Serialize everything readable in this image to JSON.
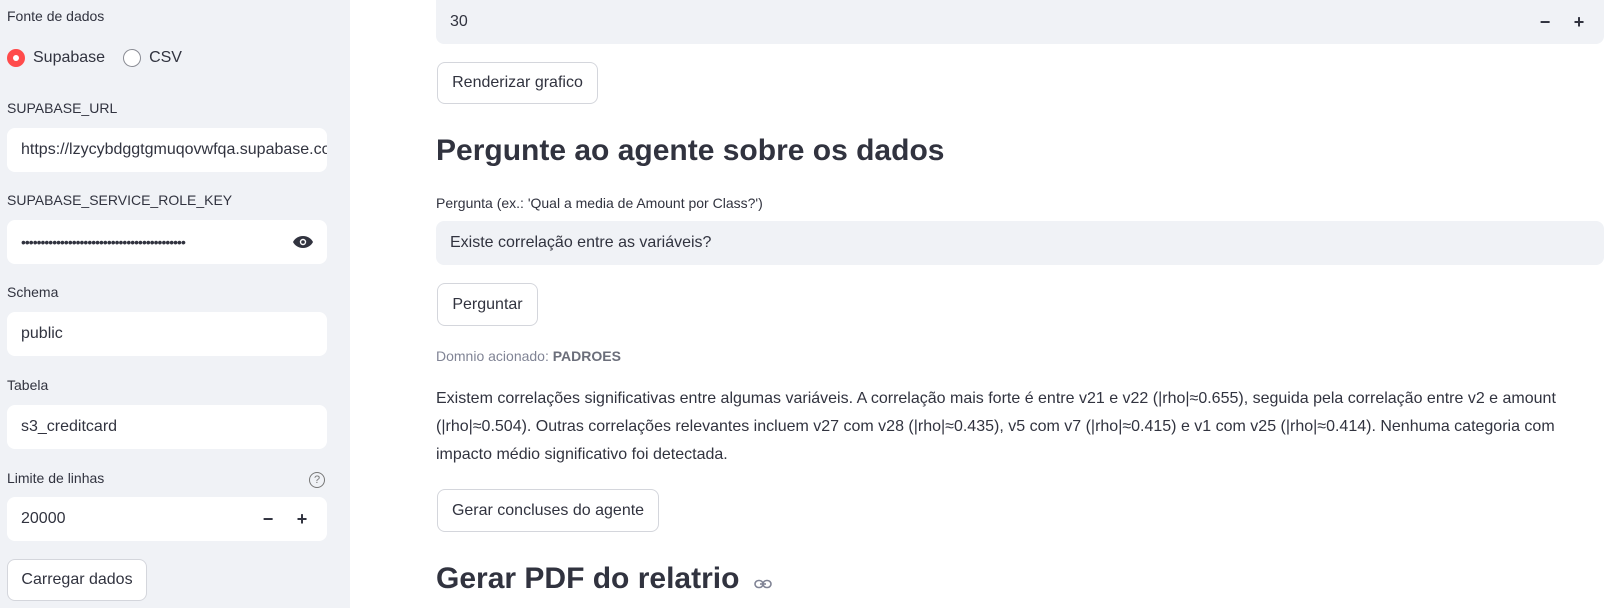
{
  "sidebar": {
    "data_source_label": "Fonte de dados",
    "radio_options": [
      {
        "label": "Supabase",
        "checked": true
      },
      {
        "label": "CSV",
        "checked": false
      }
    ],
    "url_label": "SUPABASE_URL",
    "url_value": "https://lzycybdggtgmuqovwfqa.supabase.co",
    "key_label": "SUPABASE_SERVICE_ROLE_KEY",
    "key_value": "••••••••••••••••••••••••••••••••••••••••••",
    "schema_label": "Schema",
    "schema_value": "public",
    "table_label": "Tabela",
    "table_value": "s3_creditcard",
    "limit_label": "Limite de linhas",
    "limit_value": "20000",
    "load_button": "Carregar dados"
  },
  "main": {
    "top_number_value": "30",
    "render_button": "Renderizar grafico",
    "ask_heading": "Pergunte ao agente sobre os dados",
    "question_label": "Pergunta (ex.: 'Qual a media de Amount por Class?')",
    "question_value": "Existe correlação entre as variáveis?",
    "ask_button": "Perguntar",
    "domain_caption_prefix": "Domnio acionado: ",
    "domain_caption_value": "PADROES",
    "answer_text": "Existem correlações significativas entre algumas variáveis. A correlação mais forte é entre v21 e v22 (|rho|≈0.655), seguida pela correlação entre v2 e amount (|rho|≈0.504). Outras correlações relevantes incluem v27 com v28 (|rho|≈0.435), v5 com v7 (|rho|≈0.415) e v1 com v25 (|rho|≈0.414). Nenhuma categoria com impacto médio significativo foi detectada.",
    "conclusions_button": "Gerar concluses do agente",
    "pdf_heading": "Gerar PDF do relatrio"
  },
  "colors": {
    "accent": "#ff4b4b",
    "sidebar_bg": "#f0f2f6",
    "text": "#31333f"
  }
}
